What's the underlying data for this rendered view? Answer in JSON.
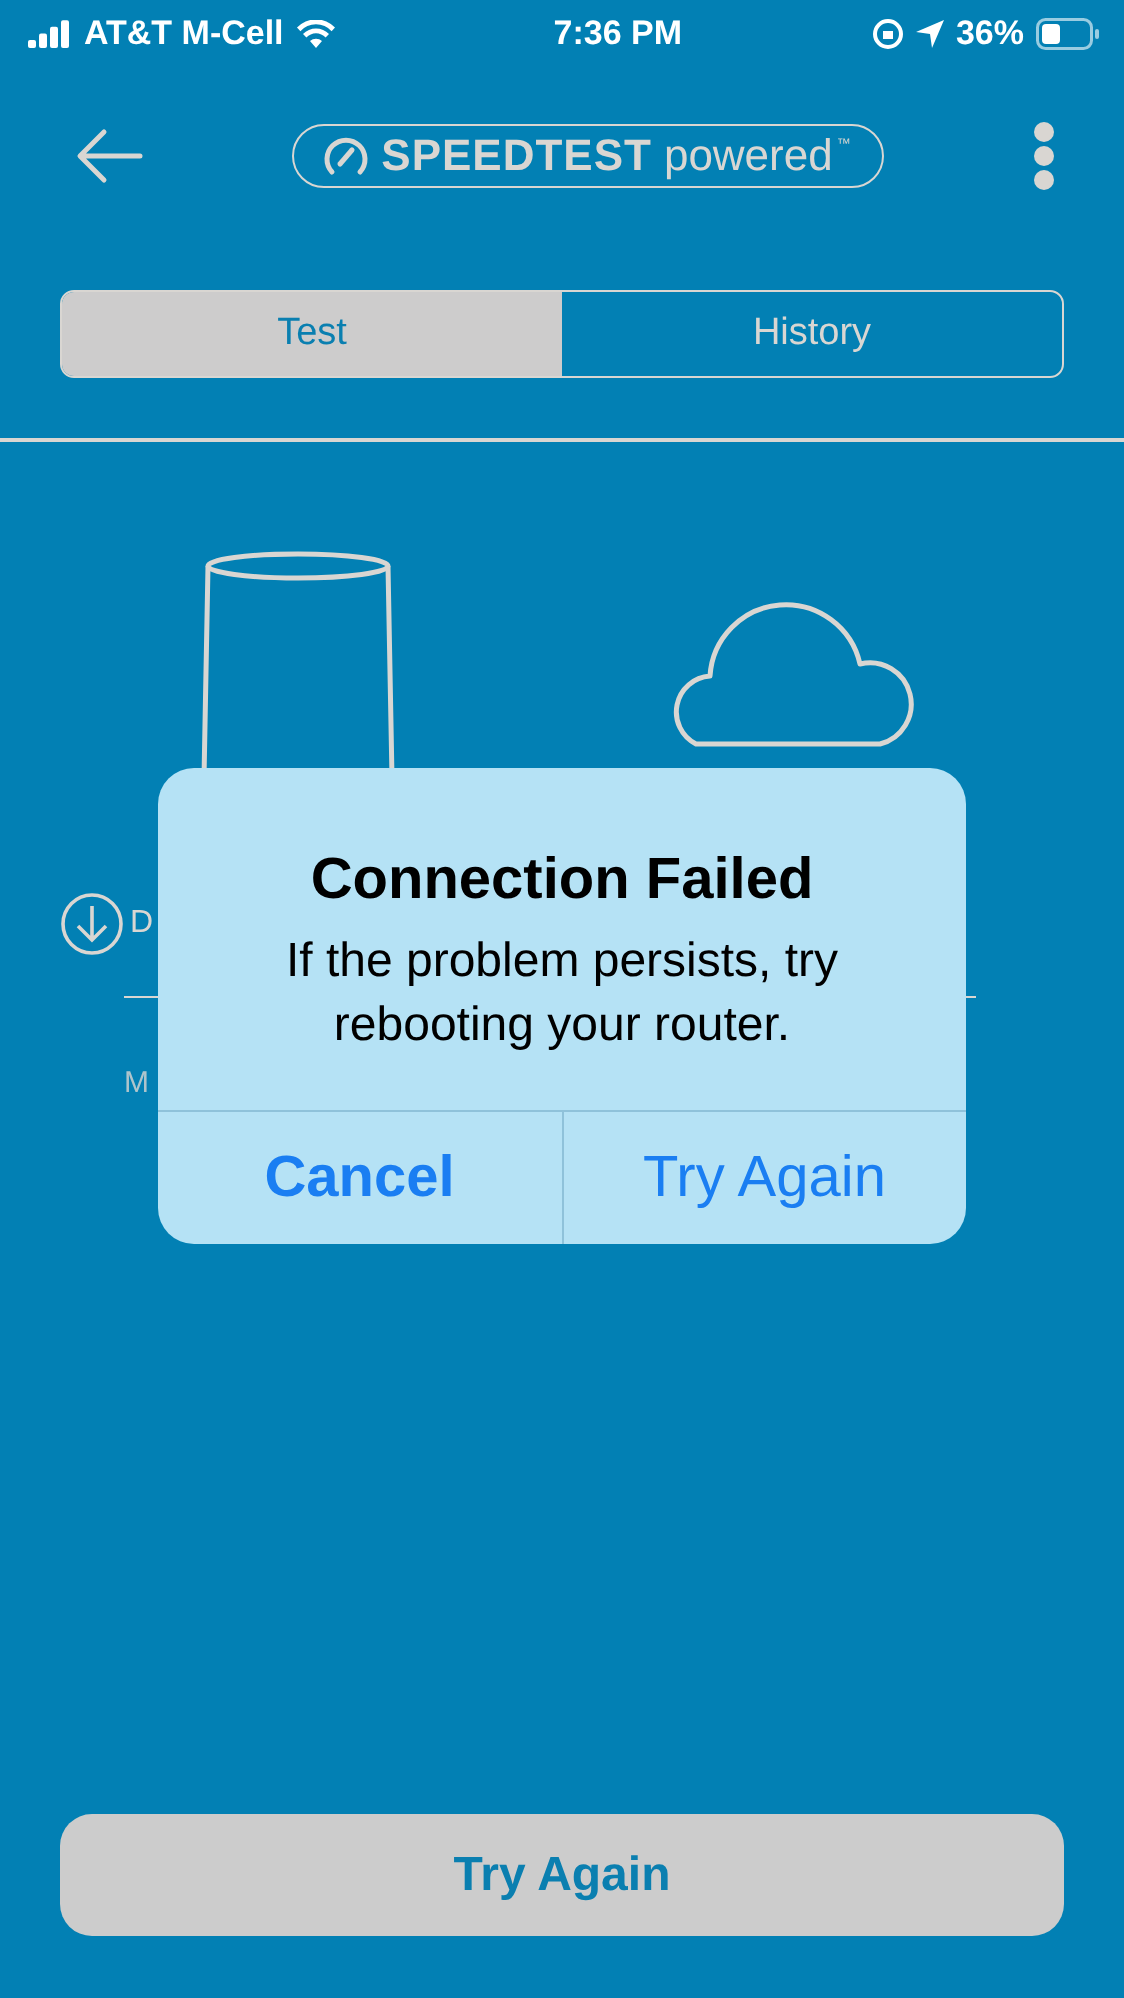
{
  "status_bar": {
    "carrier": "AT&T M-Cell",
    "time": "7:36 PM",
    "battery": "36%"
  },
  "header": {
    "logo_word": "SPEEDTEST",
    "logo_suffix": "powered",
    "trademark": "™"
  },
  "tabs": [
    {
      "label": "Test",
      "selected": true
    },
    {
      "label": "History",
      "selected": false
    }
  ],
  "result": {
    "label": "D",
    "unit": "M"
  },
  "dialog": {
    "title": "Connection Failed",
    "message": "If the problem persists, try rebooting your router.",
    "buttons": [
      {
        "label": "Cancel",
        "kind": "cancel"
      },
      {
        "label": "Try Again",
        "kind": "default"
      }
    ]
  },
  "footer_button": "Try Again"
}
